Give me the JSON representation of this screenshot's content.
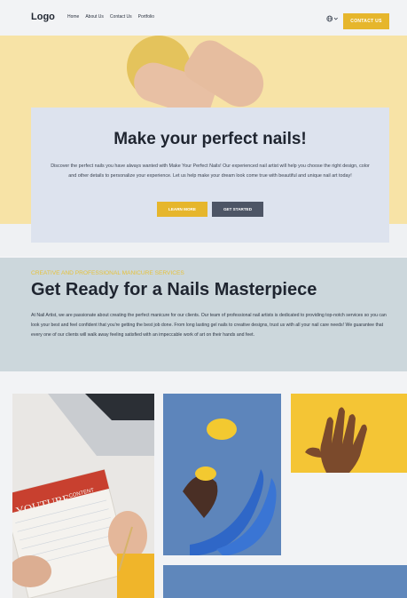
{
  "nav": {
    "logo": "Logo",
    "links": [
      "Home",
      "About Us",
      "Contact Us",
      "Portfolio"
    ],
    "language_icon": "globe-icon",
    "contact_button": "CONTACT US"
  },
  "hero": {
    "title": "Make your perfect nails!",
    "description": "Discover the perfect nails you have always wanted with Make Your Perfect Nails! Our experienced nail artist will help you choose the right design, color and other details to personalize your experience. Let us help make your dream look come true with beautiful and unique nail art today!",
    "learn_more": "LEARN MORE",
    "get_started": "GET STARTED"
  },
  "about": {
    "eyebrow": "CREATIVE AND PROFESSIONAL MANICURE SERVICES",
    "title": "Get Ready for a Nails Masterpiece",
    "body": "At Nail Artist, we are passionate about creating the perfect manicure for our clients. Our team of professional nail artists is dedicated to providing top-notch services so you can look your best and feel confident that you're getting the best job done. From long lasting gel nails to creative designs, trust us with all your nail care needs! We guarantee that every one of our clients will walk away feeling satisfied with an impeccable work of art on their hands and feet."
  },
  "gallery": {
    "notebook_heading": "YOUTUBE",
    "notebook_subheading": "CONTENT"
  },
  "colors": {
    "accent": "#e6b62c",
    "dark_button": "#4d5565",
    "hero_card": "#dde3ee",
    "section_bg": "#ccd7dc",
    "hero_bg": "#f7e3a6"
  }
}
